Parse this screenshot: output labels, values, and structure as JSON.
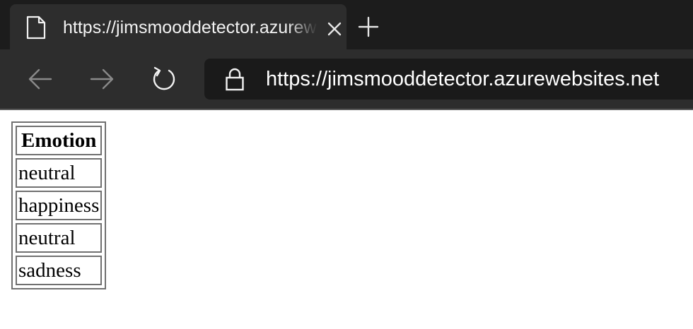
{
  "browser": {
    "tab": {
      "title": "https://jimsmooddetector.azurewebsites.net",
      "icon": "document-icon",
      "close_icon": "close-icon"
    },
    "new_tab_icon": "plus-icon",
    "nav": {
      "back_icon": "arrow-left-icon",
      "forward_icon": "arrow-right-icon",
      "refresh_icon": "refresh-icon"
    },
    "address_bar": {
      "lock_icon": "lock-icon",
      "url_scheme": "https://",
      "url_host": "jimsmooddetector.azurewebsites.net"
    },
    "colors": {
      "tabstrip_bg": "#1c1c1c",
      "toolbar_bg": "#2d2d2d",
      "address_bg": "#1a1a1a",
      "text": "#ffffff"
    }
  },
  "page": {
    "table": {
      "header": "Emotion",
      "rows": [
        "neutral",
        "happiness",
        "neutral",
        "sadness"
      ]
    }
  }
}
